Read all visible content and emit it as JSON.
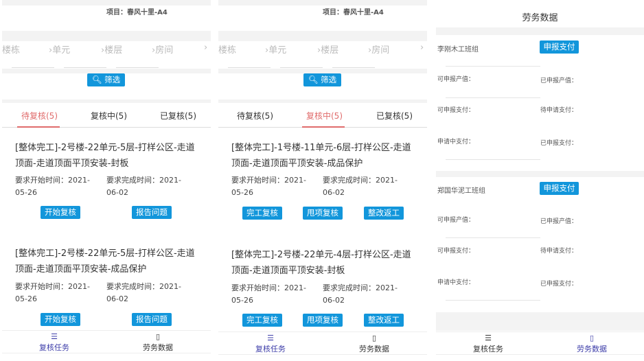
{
  "project_label": "项目：春风十里-A4",
  "breadcrumb": [
    "楼栋",
    "单元",
    "楼层",
    "房间"
  ],
  "filter_label": "筛选",
  "tabs": [
    "待复核(5)",
    "复核中(5)",
    "已复核(5)"
  ],
  "start_label": "要求开始时间：",
  "end_label": "要求完成时间：",
  "screen1": {
    "cards": [
      {
        "title": "[整体完工]-2号楼-22单元-5层-打样公区-走道顶面-走道顶面平顶安装-封板",
        "start": "2021-05-26",
        "end": "2021-06-02",
        "buttons": [
          "开始复核",
          "报告问题"
        ]
      },
      {
        "title": "[整体完工]-2号楼-22单元-5层-打样公区-走道顶面-走道顶面平顶安装-成品保护",
        "start": "2021-05-26",
        "end": "2021-06-02",
        "buttons": [
          "开始复核",
          "报告问题"
        ]
      }
    ]
  },
  "screen2": {
    "cards": [
      {
        "title": "[整体完工]-1号楼-11单元-6层-打样公区-走道顶面-走道顶面平顶安装-成品保护",
        "start": "2021-05-26",
        "end": "2021-06-02",
        "buttons": [
          "完工复核",
          "甩项复核",
          "整改返工"
        ]
      },
      {
        "title": "[整体完工]-2号楼-22单元-4层-打样公区-走道顶面-走道顶面平顶安装-封板",
        "start": "2021-05-26",
        "end": "2021-06-02",
        "buttons": [
          "完工复核",
          "甩项复核",
          "整改返工"
        ]
      }
    ]
  },
  "screen3": {
    "title": "劳务数据",
    "pay_button": "申报支付",
    "groups": [
      {
        "name": "李刚木工班组",
        "labels": [
          "可申报产值：",
          "已申报产值：",
          "可申报支付：",
          "待申请支付：",
          "申请中支付：",
          "已申报支付："
        ]
      },
      {
        "name": "郑国华泥工班组",
        "labels": [
          "可申报产值：",
          "已申报产值：",
          "可申报支付：",
          "待申请支付：",
          "申请中支付：",
          "已申报支付："
        ]
      }
    ]
  },
  "nav": [
    "复核任务",
    "劳务数据"
  ],
  "colors": {
    "accent": "#1296db",
    "active_tab": "#e06b6b",
    "active_nav": "#3c3ca8"
  }
}
